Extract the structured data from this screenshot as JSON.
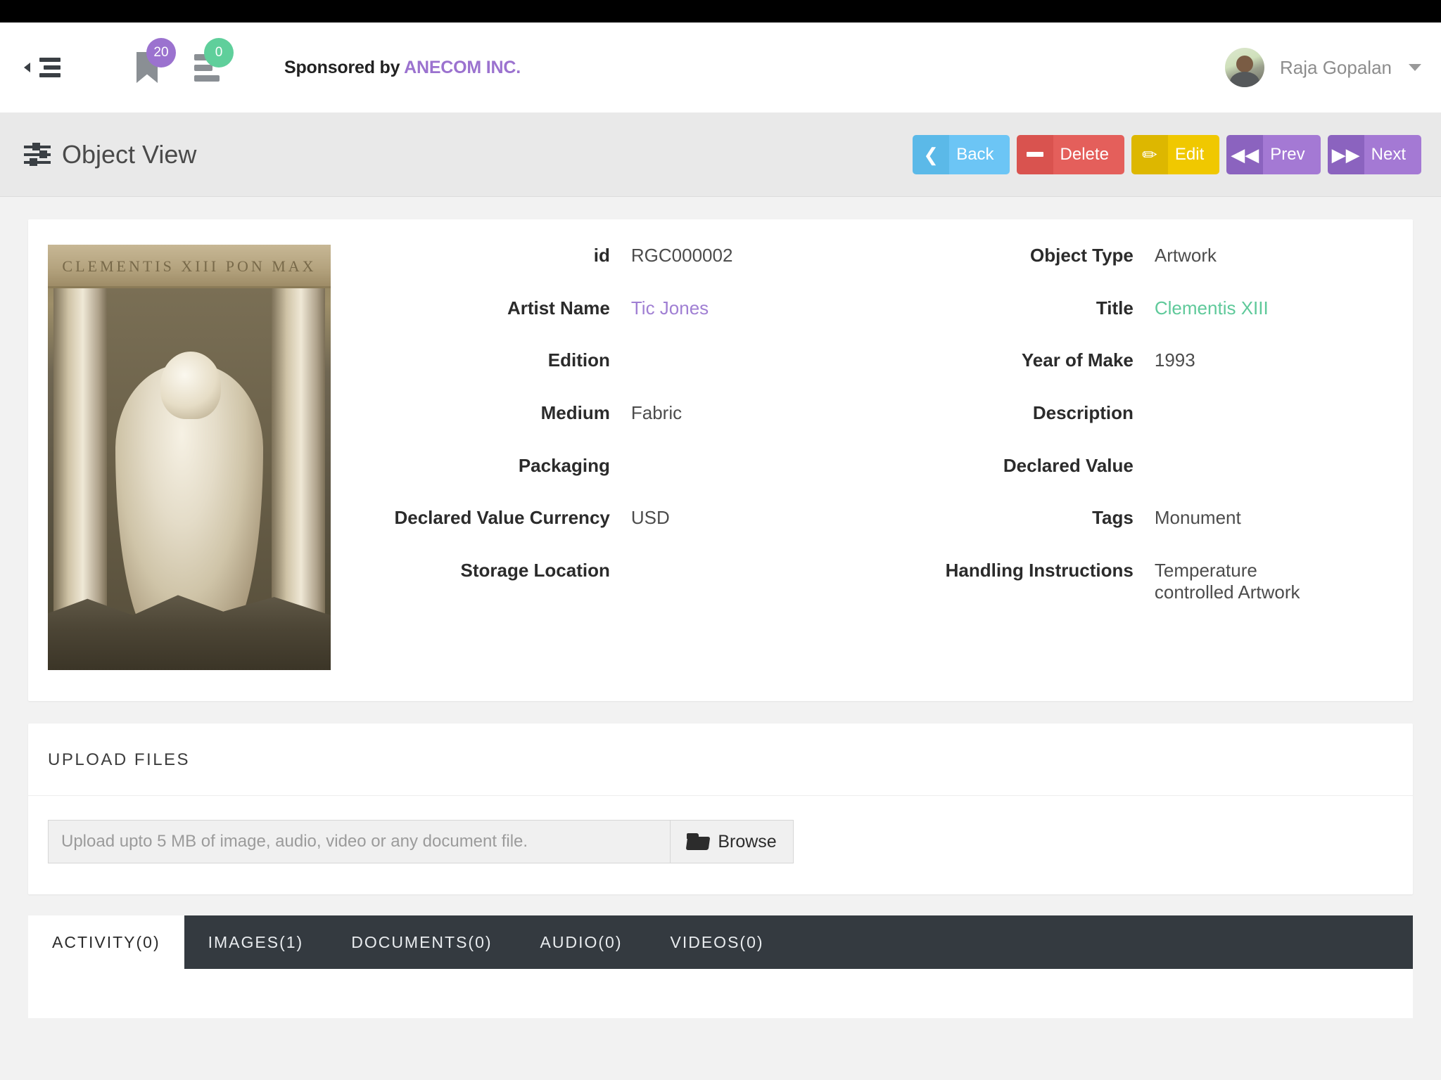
{
  "header": {
    "collapse_icon": "collapse-sidebar-icon",
    "bookmark_badge": "20",
    "stack_badge": "0",
    "sponsor_prefix": "Sponsored by ",
    "sponsor_brand": "ANECOM INC.",
    "username": "Raja Gopalan"
  },
  "subheader": {
    "title": "Object View",
    "buttons": [
      {
        "label": "Back",
        "icon": "chevron-left-icon",
        "color": "#6cc5f5"
      },
      {
        "label": "Delete",
        "icon": "minus-icon",
        "color": "#e45f5b"
      },
      {
        "label": "Edit",
        "icon": "pencil-icon",
        "color": "#f0c800"
      },
      {
        "label": "Prev",
        "icon": "double-chevron-left-icon",
        "color": "#a479d4"
      },
      {
        "label": "Next",
        "icon": "double-chevron-right-icon",
        "color": "#a479d4"
      }
    ]
  },
  "object": {
    "image_alt": "Trevi Fountain Oceanus statue",
    "left_fields": [
      {
        "label": "id",
        "value": "RGC000002",
        "style": "plain"
      },
      {
        "label": "Artist Name",
        "value": "Tic Jones",
        "style": "link-purple"
      },
      {
        "label": "Edition",
        "value": "",
        "style": "plain"
      },
      {
        "label": "Medium",
        "value": "Fabric",
        "style": "plain"
      },
      {
        "label": "Packaging",
        "value": "",
        "style": "plain"
      },
      {
        "label": "Declared Value Currency",
        "value": "USD",
        "style": "plain"
      },
      {
        "label": "Storage Location",
        "value": "",
        "style": "plain"
      }
    ],
    "right_fields": [
      {
        "label": "Object Type",
        "value": "Artwork",
        "style": "plain"
      },
      {
        "label": "Title",
        "value": "Clementis XIII",
        "style": "link-green"
      },
      {
        "label": "Year of Make",
        "value": "1993",
        "style": "plain"
      },
      {
        "label": "Description",
        "value": "",
        "style": "plain"
      },
      {
        "label": "Declared Value",
        "value": "",
        "style": "plain"
      },
      {
        "label": "Tags",
        "value": "Monument",
        "style": "plain"
      },
      {
        "label": "Handling Instructions",
        "value": "Temperature controlled Artwork",
        "style": "plain"
      }
    ]
  },
  "upload": {
    "section_title": "UPLOAD FILES",
    "placeholder": "Upload upto 5 MB of image, audio, video or any document file.",
    "browse_label": "Browse"
  },
  "tabs": [
    {
      "label": "ACTIVITY(0)",
      "active": true
    },
    {
      "label": "IMAGES(1)",
      "active": false
    },
    {
      "label": "DOCUMENTS(0)",
      "active": false
    },
    {
      "label": "AUDIO(0)",
      "active": false
    },
    {
      "label": "VIDEOS(0)",
      "active": false
    }
  ],
  "colors": {
    "accent_purple": "#9b72cf",
    "accent_green": "#5fcf9b",
    "tabbar_dark": "#343a40",
    "page_bg": "#f2f2f2"
  }
}
